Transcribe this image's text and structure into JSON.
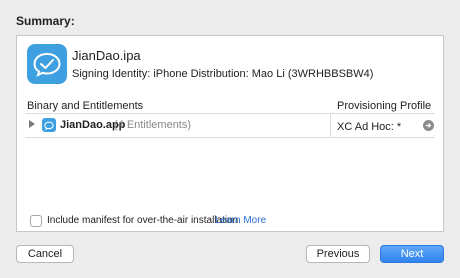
{
  "summary_heading": "Summary:",
  "app": {
    "ipa_name": "JianDao.ipa",
    "signing_identity": "Signing Identity: iPhone Distribution: Mao Li (3WRHBBSBW4)"
  },
  "table": {
    "col_binary": "Binary and Entitlements",
    "col_profile": "Provisioning Profile",
    "row": {
      "app_file": "JianDao.app",
      "entitlements": "(4 Entitlements)",
      "profile": "XC Ad Hoc: *"
    }
  },
  "manifest": {
    "label": "Include manifest for over-the-air installation.",
    "link": "Learn More",
    "checked": false
  },
  "buttons": {
    "cancel": "Cancel",
    "previous": "Previous",
    "next": "Next"
  },
  "colors": {
    "accent": "#2f84ee",
    "app_icon": "#3ea0e0",
    "link": "#2a6fd6"
  }
}
